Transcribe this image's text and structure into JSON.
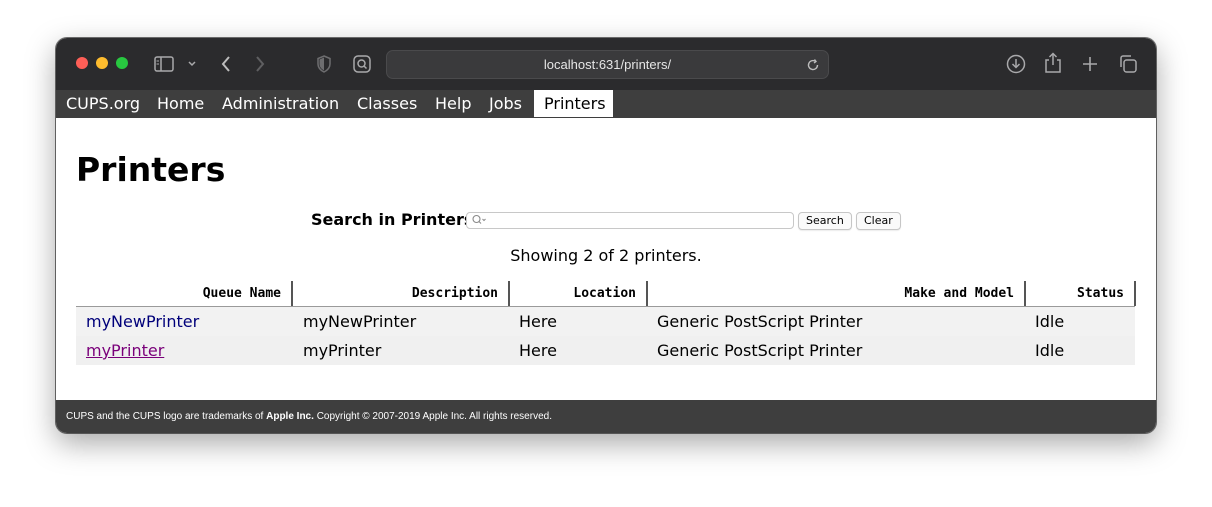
{
  "browser": {
    "url": "localhost:631/printers/"
  },
  "nav": {
    "items": [
      "CUPS.org",
      "Home",
      "Administration",
      "Classes",
      "Help",
      "Jobs",
      "Printers"
    ],
    "active": "Printers"
  },
  "page": {
    "title": "Printers",
    "search_label": "Search in Printers:",
    "search_value": "",
    "search_button": "Search",
    "clear_button": "Clear",
    "showing": "Showing 2 of 2 printers."
  },
  "table": {
    "headers": [
      "Queue Name",
      "Description",
      "Location",
      "Make and Model",
      "Status"
    ],
    "rows": [
      {
        "queue": "myNewPrinter",
        "description": "myNewPrinter",
        "location": "Here",
        "model": "Generic PostScript Printer",
        "status": "Idle"
      },
      {
        "queue": "myPrinter",
        "description": "myPrinter",
        "location": "Here",
        "model": "Generic PostScript Printer",
        "status": "Idle"
      }
    ]
  },
  "footer": {
    "text_before": "CUPS and the CUPS logo are trademarks of",
    "company": "Apple Inc.",
    "text_after": "Copyright © 2007-2019 Apple Inc. All rights reserved."
  },
  "colors": {
    "nav_bg": "#3e3e3e",
    "link": "#00007a",
    "visited_link": "#7a007a",
    "title_bar": "#2b2b2d"
  }
}
